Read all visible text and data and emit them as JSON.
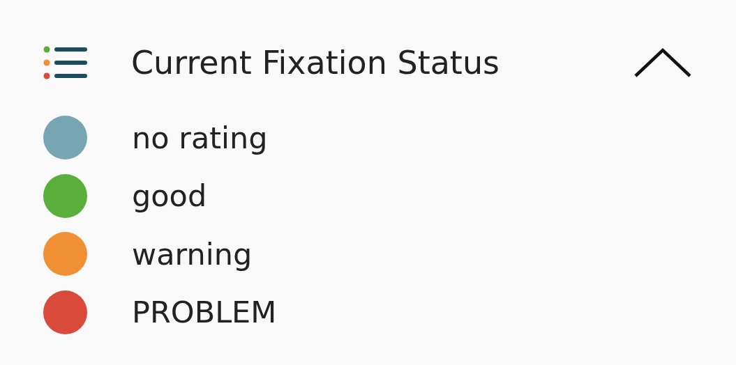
{
  "panel": {
    "title": "Current Fixation Status",
    "expanded": true
  },
  "legend": [
    {
      "label": "no rating",
      "color": "#78a5b2"
    },
    {
      "label": "good",
      "color": "#5aaf3a"
    },
    {
      "label": "warning",
      "color": "#f08f34"
    },
    {
      "label": "PROBLEM",
      "color": "#da4a3a"
    }
  ]
}
